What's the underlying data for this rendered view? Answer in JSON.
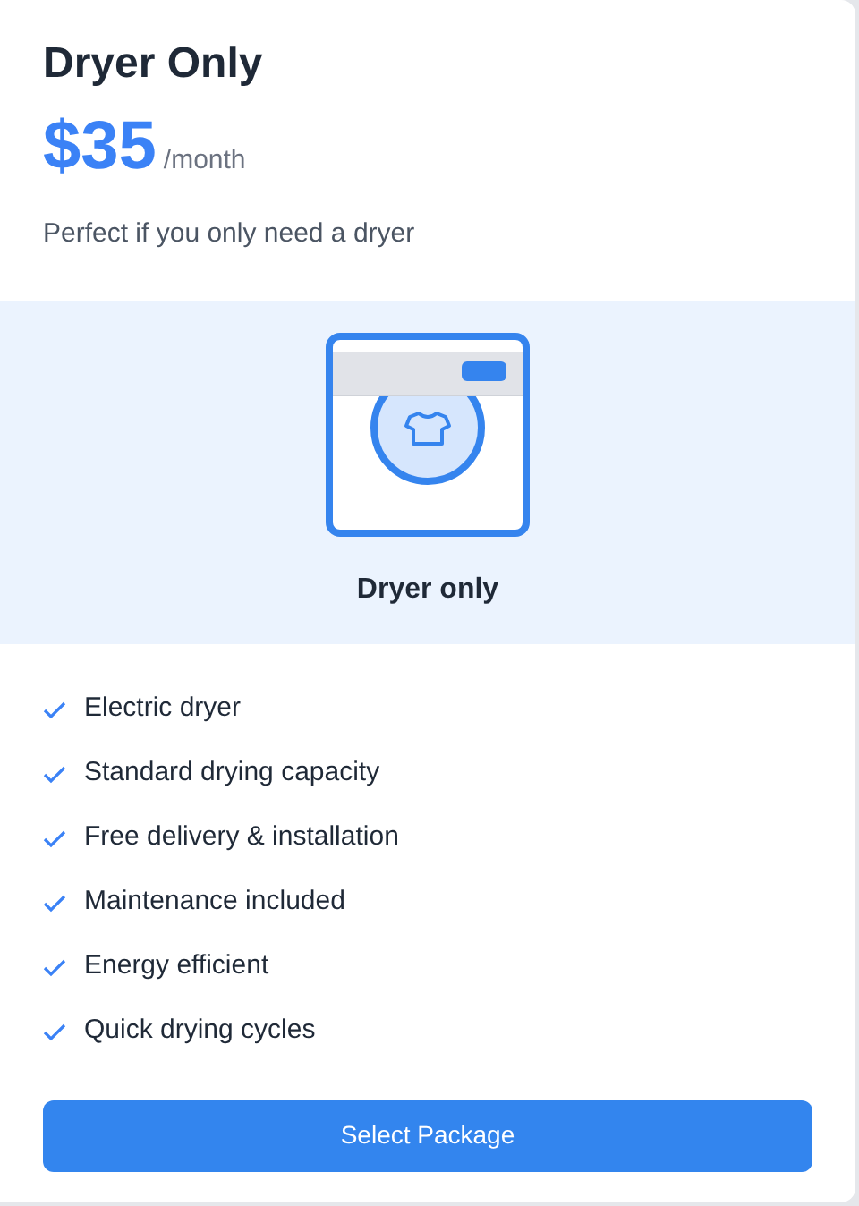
{
  "plan": {
    "title": "Dryer Only",
    "price": "$35",
    "period": "/month",
    "description": "Perfect if you only need a dryer"
  },
  "illustration": {
    "label": "Dryer only"
  },
  "features": [
    "Electric dryer",
    "Standard drying capacity",
    "Free delivery & installation",
    "Maintenance included",
    "Energy efficient",
    "Quick drying cycles"
  ],
  "button": "Select Package"
}
